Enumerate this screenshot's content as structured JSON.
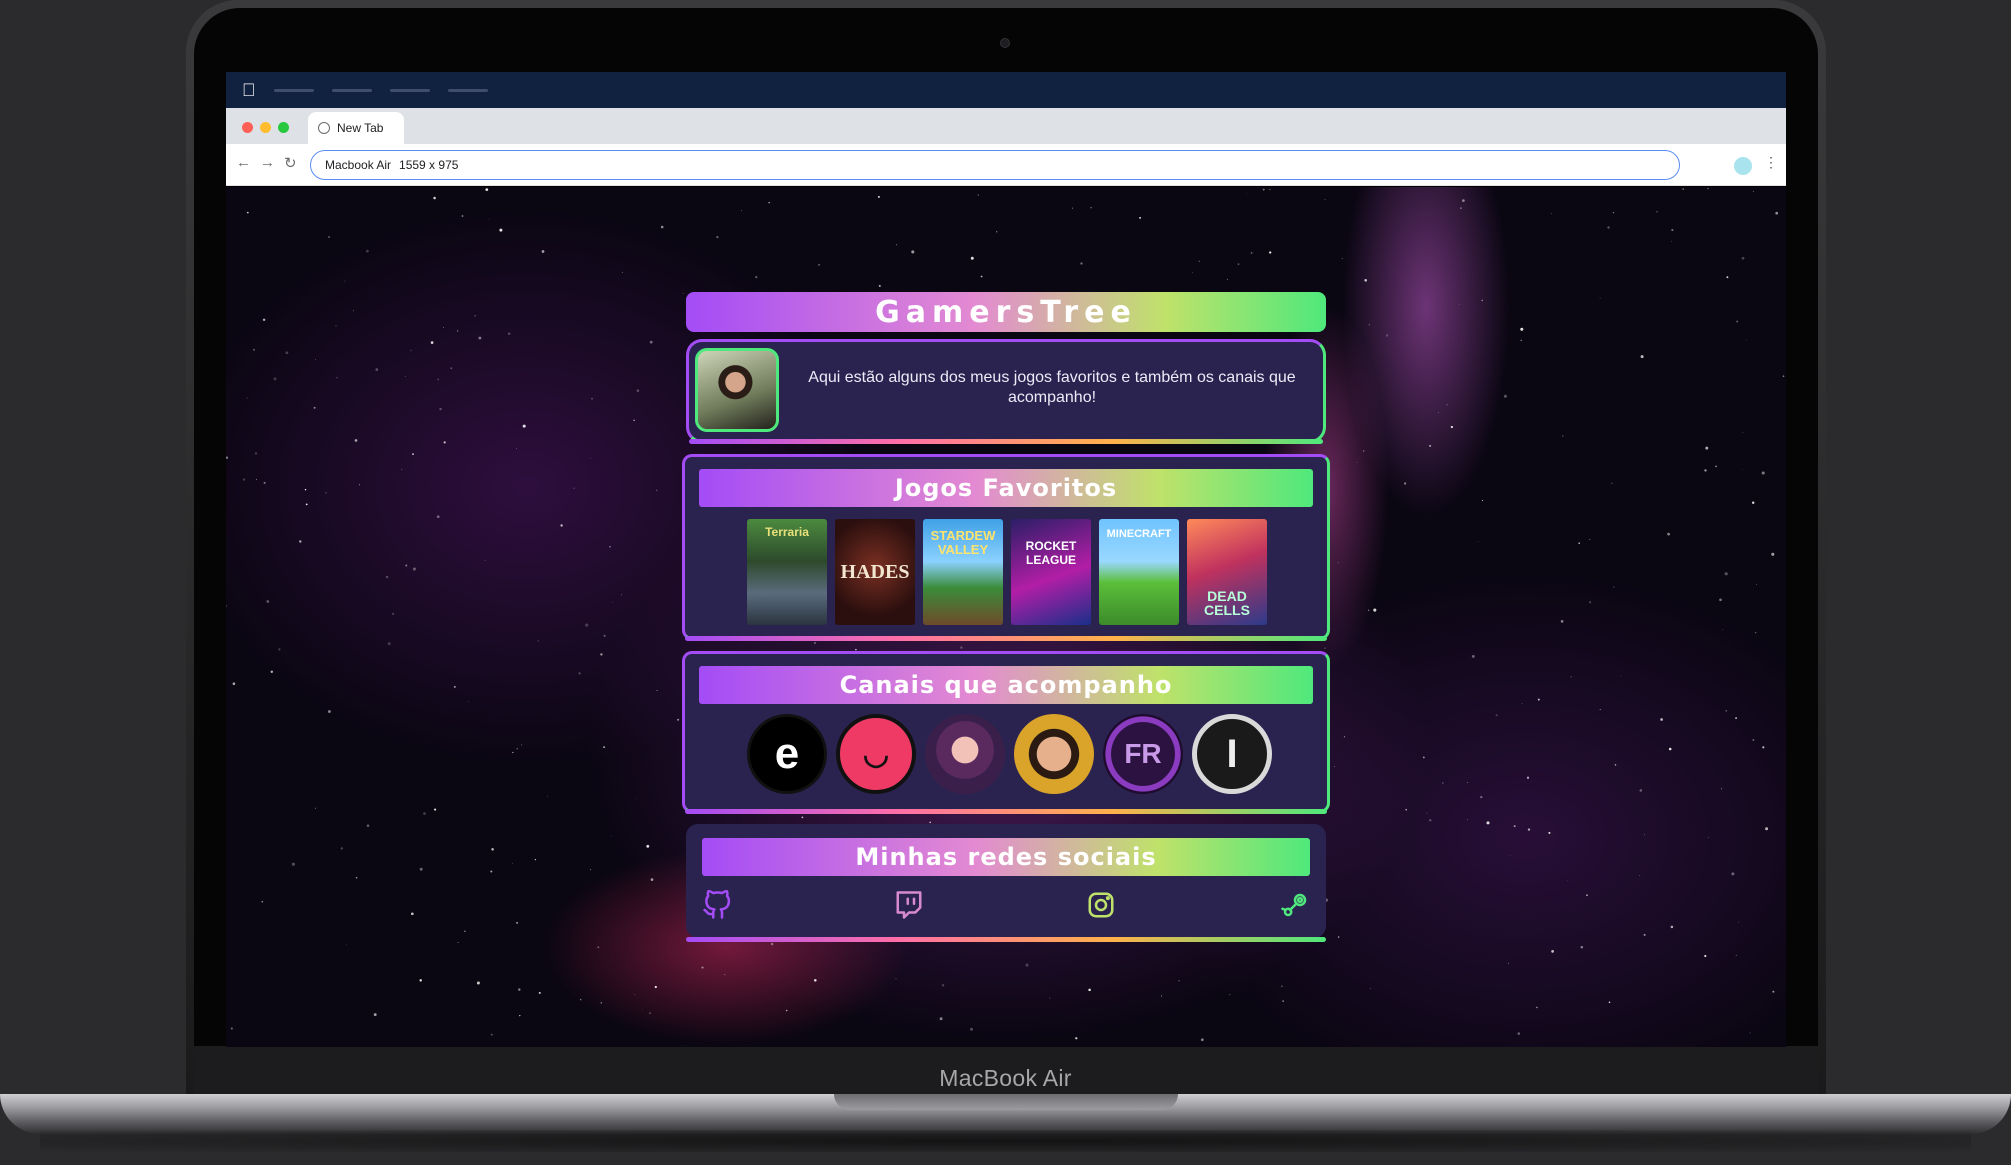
{
  "device": {
    "label": "MacBook Air"
  },
  "browser": {
    "tab_title": "New Tab",
    "address": "Macbook Air",
    "viewport": "1559 x 975"
  },
  "page": {
    "title": "GamersTree",
    "bio": "Aqui estão alguns dos meus jogos favoritos e também os canais que acompanho!",
    "games_section": {
      "header": "Jogos Favoritos",
      "games": [
        {
          "name": "Terraria",
          "cover_text": "Terraria"
        },
        {
          "name": "Hades",
          "cover_text": "HADES"
        },
        {
          "name": "Stardew Valley",
          "cover_text": "STARDEW VALLEY"
        },
        {
          "name": "Rocket League",
          "cover_text": "ROCKET LEAGUE"
        },
        {
          "name": "Minecraft",
          "cover_text": "MINECRAFT"
        },
        {
          "name": "Dead Cells",
          "cover_text": "DEAD CELLS"
        }
      ]
    },
    "channels_section": {
      "header": "Canais que acompanho",
      "channels": [
        {
          "glyph": "e"
        },
        {
          "glyph": "◡"
        },
        {
          "glyph": ""
        },
        {
          "glyph": ""
        },
        {
          "glyph": "FR"
        },
        {
          "glyph": "I"
        }
      ]
    },
    "social_section": {
      "header": "Minhas redes sociais",
      "links": [
        {
          "icon": "github-icon",
          "color": "#a44cf6"
        },
        {
          "icon": "twitch-icon",
          "color": "#d78ad0"
        },
        {
          "icon": "instagram-icon",
          "color": "#bfe26a"
        },
        {
          "icon": "steam-icon",
          "color": "#4fe87c"
        }
      ]
    }
  },
  "colors": {
    "gradient_start": "#a44cf6",
    "gradient_mid": "#e38ad2",
    "gradient_end": "#4fe87c",
    "card_bg": "#2a2350",
    "menubar": "#112241"
  }
}
